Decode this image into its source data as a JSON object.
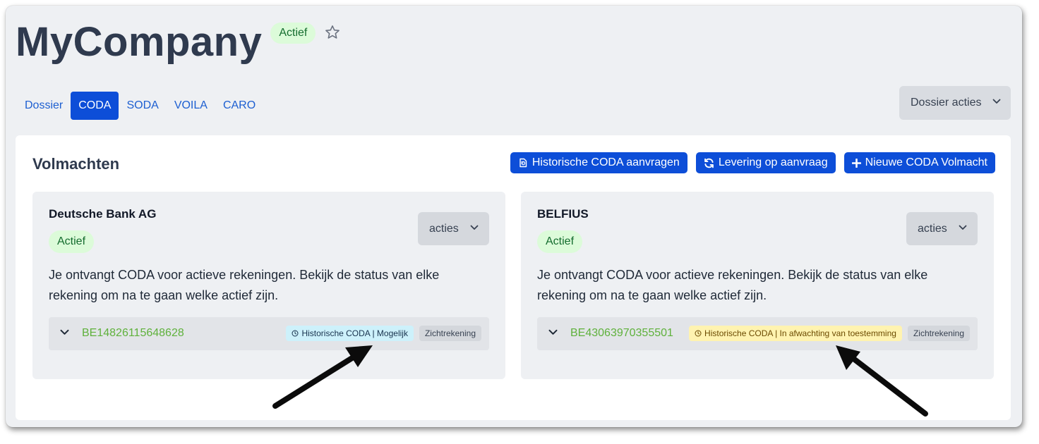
{
  "header": {
    "title": "MyCompany",
    "status_badge": "Actief",
    "favorite_icon": "star-icon"
  },
  "tabs": [
    {
      "label": "Dossier",
      "active": false
    },
    {
      "label": "CODA",
      "active": true
    },
    {
      "label": "SODA",
      "active": false
    },
    {
      "label": "VOILA",
      "active": false
    },
    {
      "label": "CARO",
      "active": false
    }
  ],
  "dossier_actions": {
    "label": "Dossier acties",
    "icon": "chevron-down-icon"
  },
  "panel": {
    "title": "Volmachten",
    "buttons": [
      {
        "label": "Historische CODA aanvragen",
        "icon": "history-document-icon"
      },
      {
        "label": "Levering op aanvraag",
        "icon": "sync-icon"
      },
      {
        "label": "Nieuwe CODA Volmacht",
        "icon": "plus-icon"
      }
    ]
  },
  "cards": [
    {
      "bank": "Deutsche Bank AG",
      "status": "Actief",
      "actions_label": "acties",
      "description": "Je ontvangt CODA voor actieve rekeningen. Bekijk de status van elke rekening om na te gaan welke actief zijn.",
      "account": {
        "iban": "BE14826115648628",
        "history_tag": "Historische CODA | Mogelijk",
        "type_tag": "Zichtrekening"
      }
    },
    {
      "bank": "BELFIUS",
      "status": "Actief",
      "actions_label": "acties",
      "description": "Je ontvangt CODA voor actieve rekeningen. Bekijk de status van elke rekening om na te gaan welke actief zijn.",
      "account": {
        "iban": "BE43063970355501",
        "history_tag": "Historische CODA | In afwachting van toestemming",
        "type_tag": "Zichtrekening"
      }
    }
  ],
  "colors": {
    "primary": "#0d4ed8",
    "active_badge_bg": "#dcfbd9",
    "iban_text": "#5fb13c",
    "tag_possible_bg": "#cdf1fb",
    "tag_pending_bg": "#fff3b0"
  }
}
